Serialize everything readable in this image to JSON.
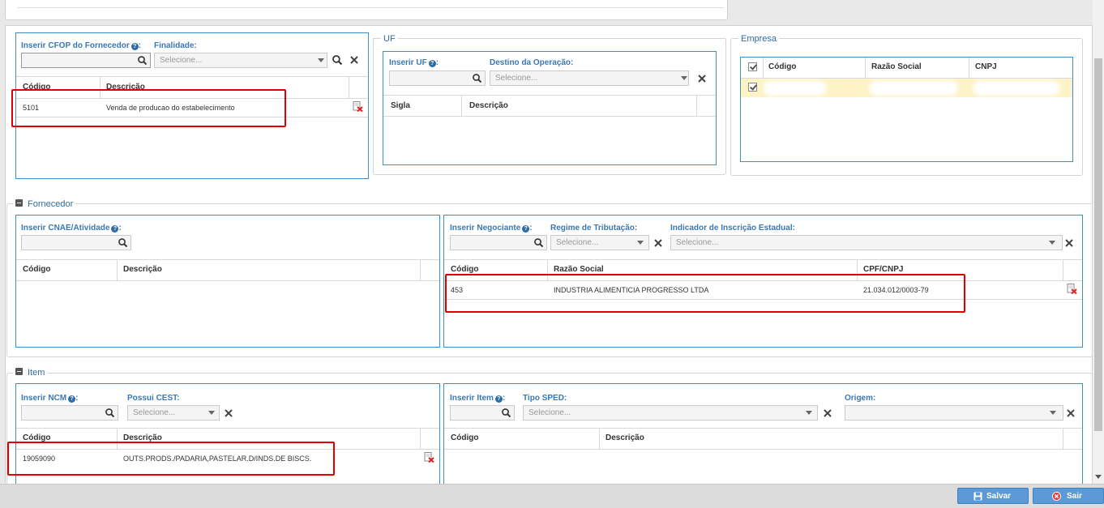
{
  "cfop": {
    "insert_label": "Inserir CFOP do Fornecedor",
    "finalidade_label": "Finalidade:",
    "finalidade_placeholder": "Selecione...",
    "headers": [
      "Código",
      "Descrição"
    ],
    "rows": [
      {
        "codigo": "5101",
        "descricao": "Venda de producao do estabelecimento"
      }
    ]
  },
  "uf": {
    "legend": "UF",
    "insert_label": "Inserir UF",
    "destino_label": "Destino da Operação:",
    "destino_placeholder": "Selecione...",
    "headers": [
      "Sigla",
      "Descrição"
    ]
  },
  "empresa": {
    "legend": "Empresa",
    "headers": [
      "Código",
      "Razão Social",
      "CNPJ"
    ]
  },
  "fornecedor": {
    "legend": "Fornecedor",
    "cnae_label": "Inserir CNAE/Atividade",
    "cnae_headers": [
      "Código",
      "Descrição"
    ],
    "negociante_label": "Inserir Negociante",
    "regime_label": "Regime de Tributação:",
    "regime_placeholder": "Selecione...",
    "ie_label": "Indicador de Inscrição Estadual:",
    "ie_placeholder": "Selecione...",
    "neg_headers": [
      "Código",
      "Razão Social",
      "CPF/CNPJ"
    ],
    "neg_rows": [
      {
        "codigo": "453",
        "razao": "INDUSTRIA ALIMENTICIA PROGRESSO LTDA",
        "cnpj": "21.034.012/0003-79"
      }
    ]
  },
  "item": {
    "legend": "Item",
    "ncm_label": "Inserir NCM",
    "cest_label": "Possui CEST:",
    "cest_placeholder": "Selecione...",
    "ncm_headers": [
      "Código",
      "Descrição"
    ],
    "ncm_rows": [
      {
        "codigo": "19059090",
        "descricao": "OUTS.PRODS./PADARIA,PASTELAR.D/INDS.DE BISCS."
      }
    ],
    "item_label": "Inserir Item",
    "sped_label": "Tipo SPED:",
    "sped_placeholder": "Selecione...",
    "origem_label": "Origem:",
    "item_headers": [
      "Código",
      "Descrição"
    ]
  },
  "footer": {
    "save_label": "Salvar",
    "exit_label": "Sair"
  },
  "help_glyph": "?",
  "colon": ":"
}
